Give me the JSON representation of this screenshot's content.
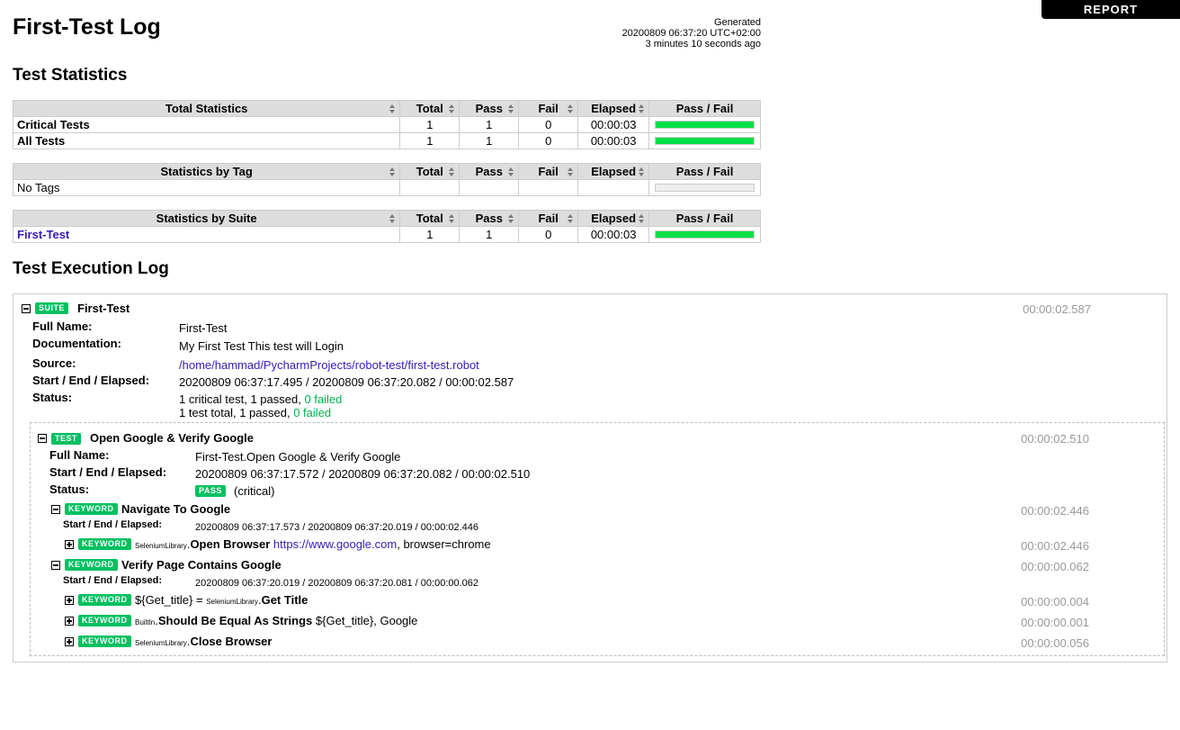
{
  "report_button": "REPORT",
  "title": "First-Test Log",
  "generated": {
    "label": "Generated",
    "timestamp": "20200809 06:37:20 UTC+02:00",
    "ago": "3 minutes 10 seconds ago"
  },
  "stats_heading": "Test Statistics",
  "columns": {
    "total": "Total",
    "pass": "Pass",
    "fail": "Fail",
    "elapsed": "Elapsed",
    "passfail": "Pass / Fail"
  },
  "total_statistics": {
    "heading": "Total Statistics",
    "rows": [
      {
        "name": "Critical Tests",
        "total": "1",
        "pass": "1",
        "fail": "0",
        "elapsed": "00:00:03",
        "pass_ratio": 1.0
      },
      {
        "name": "All Tests",
        "total": "1",
        "pass": "1",
        "fail": "0",
        "elapsed": "00:00:03",
        "pass_ratio": 1.0
      }
    ]
  },
  "tag_statistics": {
    "heading": "Statistics by Tag",
    "rows": [
      {
        "name": "No Tags",
        "total": "",
        "pass": "",
        "fail": "",
        "elapsed": "",
        "pass_ratio": 0
      }
    ]
  },
  "suite_statistics": {
    "heading": "Statistics by Suite",
    "rows": [
      {
        "name": "First-Test",
        "total": "1",
        "pass": "1",
        "fail": "0",
        "elapsed": "00:00:03",
        "pass_ratio": 1.0
      }
    ]
  },
  "log_heading": "Test Execution Log",
  "suite": {
    "label": "SUITE",
    "name": "First-Test",
    "elapsed": "00:00:02.587",
    "meta": {
      "full_name_key": "Full Name:",
      "full_name": "First-Test",
      "doc_key": "Documentation:",
      "doc": "My First Test This test will Login",
      "source_key": "Source:",
      "source": "/home/hammad/PycharmProjects/robot-test/first-test.robot",
      "times_key": "Start / End / Elapsed:",
      "times": "20200809 06:37:17.495 / 20200809 06:37:20.082 / 00:00:02.587",
      "status_key": "Status:",
      "status_line1": "1 critical test, 1 passed, ",
      "status_line1_failed": "0 failed",
      "status_line2": "1 test total, 1 passed, ",
      "status_line2_failed": "0 failed"
    }
  },
  "test": {
    "label": "TEST",
    "name": "Open Google & Verify Google",
    "elapsed": "00:00:02.510",
    "full_name_key": "Full Name:",
    "full_name": "First-Test.Open Google & Verify Google",
    "times_key": "Start / End / Elapsed:",
    "times": "20200809 06:37:17.572 / 20200809 06:37:20.082 / 00:00:02.510",
    "status_key": "Status:",
    "status_badge": "PASS",
    "status_note": "(critical)"
  },
  "keywords": [
    {
      "label": "KEYWORD",
      "name": "Navigate To Google",
      "elapsed": "00:00:02.446",
      "times_key": "Start / End / Elapsed:",
      "times": "20200809 06:37:17.573 / 20200809 06:37:20.019 / 00:00:02.446",
      "children": [
        {
          "label": "KEYWORD",
          "prefix": "",
          "lib": "SeleniumLibrary",
          "name": "Open Browser",
          "arg_link": "https://www.google.com",
          "args": ", browser=chrome",
          "elapsed": "00:00:02.446"
        }
      ]
    },
    {
      "label": "KEYWORD",
      "name": "Verify Page Contains Google",
      "elapsed": "00:00:00.062",
      "times_key": "Start / End / Elapsed:",
      "times": "20200809 06:37:20.019 / 20200809 06:37:20.081 / 00:00:00.062",
      "children": [
        {
          "label": "KEYWORD",
          "prefix": "${Get_title} = ",
          "lib": "SeleniumLibrary",
          "name": "Get Title",
          "arg_link": "",
          "args": "",
          "elapsed": "00:00:00.004"
        },
        {
          "label": "KEYWORD",
          "prefix": "",
          "lib": "BuiltIn",
          "name": "Should Be Equal As Strings",
          "arg_link": "",
          "args": "${Get_title}, Google",
          "elapsed": "00:00:00.001"
        },
        {
          "label": "KEYWORD",
          "prefix": "",
          "lib": "SeleniumLibrary",
          "name": "Close Browser",
          "arg_link": "",
          "args": "",
          "elapsed": "00:00:00.056"
        }
      ]
    }
  ]
}
